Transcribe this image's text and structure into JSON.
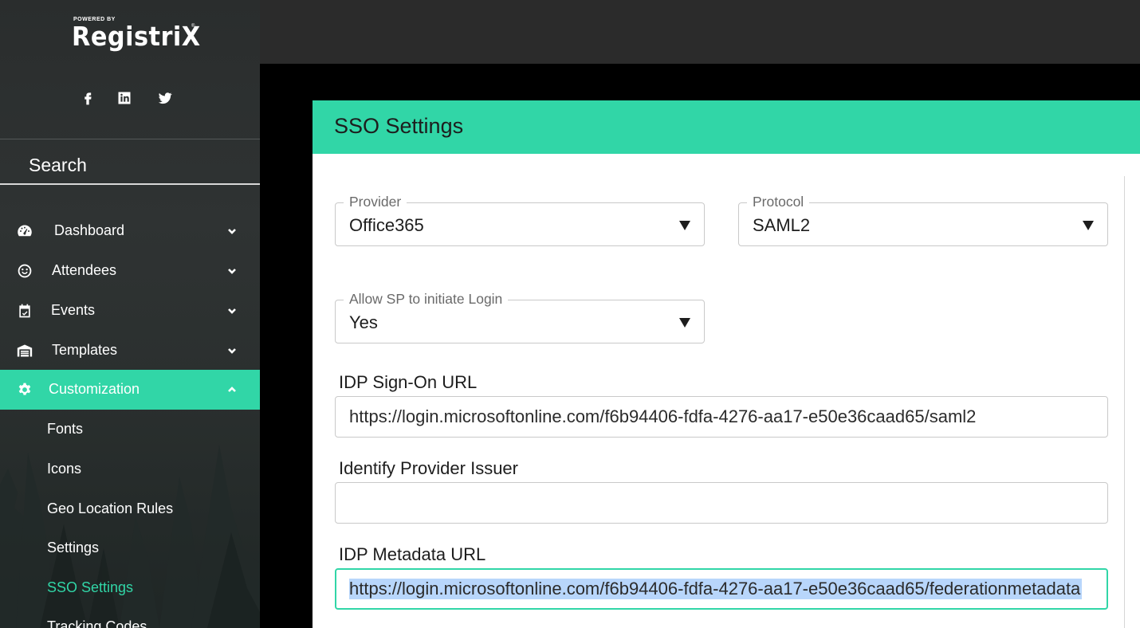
{
  "brand": {
    "powered_by": "POWERED BY",
    "name": "RegistriX",
    "tm": "®"
  },
  "social": [
    {
      "icon": "facebook-icon"
    },
    {
      "icon": "linkedin-icon"
    },
    {
      "icon": "twitter-icon"
    }
  ],
  "search": {
    "label": "Search"
  },
  "nav": {
    "items": [
      {
        "label": "Dashboard",
        "icon": "dashboard-gauge-icon",
        "expanded": false
      },
      {
        "label": "Attendees",
        "icon": "smiley-icon",
        "expanded": false
      },
      {
        "label": "Events",
        "icon": "calendar-check-icon",
        "expanded": false
      },
      {
        "label": "Templates",
        "icon": "warehouse-icon",
        "expanded": false
      },
      {
        "label": "Customization",
        "icon": "gear-icon",
        "expanded": true,
        "active": true
      }
    ],
    "subitems": [
      {
        "label": "Fonts"
      },
      {
        "label": "Icons"
      },
      {
        "label": "Geo Location Rules"
      },
      {
        "label": "Settings"
      },
      {
        "label": "SSO Settings",
        "active": true
      },
      {
        "label": "Tracking Codes"
      }
    ]
  },
  "colors": {
    "accent": "#31d6a7",
    "sidebar_bg": "#2f3333",
    "topbar_bg": "#2b2b2b",
    "selection": "#b8d6fb"
  },
  "card": {
    "title": "SSO Settings",
    "provider": {
      "legend": "Provider",
      "value": "Office365"
    },
    "protocol": {
      "legend": "Protocol",
      "value": "SAML2"
    },
    "allow_sp": {
      "legend": "Allow SP to initiate Login",
      "value": "Yes"
    },
    "idp_signon": {
      "label": "IDP Sign-On URL",
      "value": "https://login.microsoftonline.com/f6b94406-fdfa-4276-aa17-e50e36caad65/saml2"
    },
    "issuer": {
      "label": "Identify Provider Issuer",
      "value": ""
    },
    "metadata": {
      "label": "IDP Metadata URL",
      "value": "https://login.microsoftonline.com/f6b94406-fdfa-4276-aa17-e50e36caad65/federationmetadata"
    }
  }
}
